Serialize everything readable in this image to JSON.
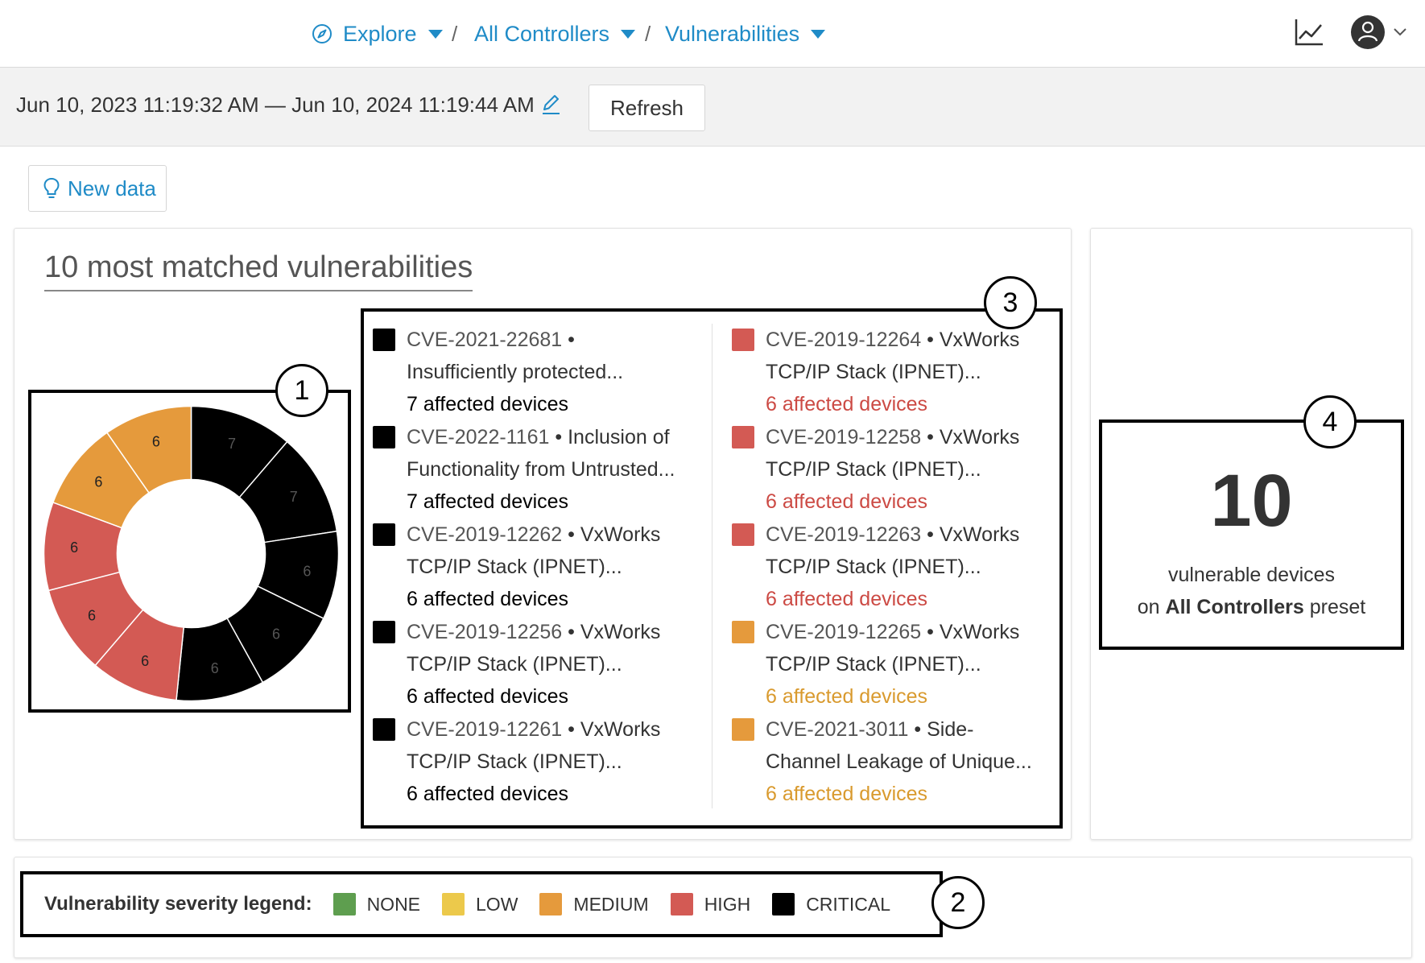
{
  "breadcrumb": {
    "explore": "Explore",
    "controllers": "All Controllers",
    "vulnerabilities": "Vulnerabilities",
    "separator": "/"
  },
  "header_icons": [
    "compass-icon",
    "line-chart-icon",
    "user-avatar-icon",
    "chevron-down-icon"
  ],
  "toolbar": {
    "date_range": "Jun 10, 2023 11:19:32 AM — Jun 10, 2024 11:19:44 AM",
    "refresh_label": "Refresh",
    "new_data_label": "New data"
  },
  "vulnerabilities_panel": {
    "title": "10 most matched vulnerabilities",
    "items": [
      {
        "cve": "CVE-2021-22681",
        "line1_rest": "•",
        "line2": "Insufficiently protected...",
        "affected": "7 affected devices",
        "severity": "critical"
      },
      {
        "cve": "CVE-2022-1161",
        "line1_rest": "• Inclusion of",
        "line2": "Functionality from Untrusted...",
        "affected": "7 affected devices",
        "severity": "critical"
      },
      {
        "cve": "CVE-2019-12262",
        "line1_rest": "• VxWorks",
        "line2": "TCP/IP Stack (IPNET)...",
        "affected": "6 affected devices",
        "severity": "critical"
      },
      {
        "cve": "CVE-2019-12256",
        "line1_rest": "• VxWorks",
        "line2": "TCP/IP Stack (IPNET)...",
        "affected": "6 affected devices",
        "severity": "critical"
      },
      {
        "cve": "CVE-2019-12261",
        "line1_rest": "• VxWorks",
        "line2": "TCP/IP Stack (IPNET)...",
        "affected": "6 affected devices",
        "severity": "critical"
      },
      {
        "cve": "CVE-2019-12264",
        "line1_rest": "• VxWorks",
        "line2": "TCP/IP Stack (IPNET)...",
        "affected": "6 affected devices",
        "severity": "high"
      },
      {
        "cve": "CVE-2019-12258",
        "line1_rest": "• VxWorks",
        "line2": "TCP/IP Stack (IPNET)...",
        "affected": "6 affected devices",
        "severity": "high"
      },
      {
        "cve": "CVE-2019-12263",
        "line1_rest": "• VxWorks",
        "line2": "TCP/IP Stack (IPNET)...",
        "affected": "6 affected devices",
        "severity": "high"
      },
      {
        "cve": "CVE-2019-12265",
        "line1_rest": "• VxWorks",
        "line2": "TCP/IP Stack (IPNET)...",
        "affected": "6 affected devices",
        "severity": "medium"
      },
      {
        "cve": "CVE-2021-3011",
        "line1_rest": "• Side-",
        "line2": "Channel Leakage of Unique...",
        "affected": "6 affected devices",
        "severity": "medium"
      }
    ]
  },
  "donut": {
    "segments": [
      {
        "value": 7,
        "severity": "critical"
      },
      {
        "value": 7,
        "severity": "critical"
      },
      {
        "value": 6,
        "severity": "critical"
      },
      {
        "value": 6,
        "severity": "critical"
      },
      {
        "value": 6,
        "severity": "critical"
      },
      {
        "value": 6,
        "severity": "high"
      },
      {
        "value": 6,
        "severity": "high"
      },
      {
        "value": 6,
        "severity": "high"
      },
      {
        "value": 6,
        "severity": "medium"
      },
      {
        "value": 6,
        "severity": "medium"
      }
    ]
  },
  "count_panel": {
    "number": "10",
    "line1": "vulnerable devices",
    "line2_prefix": "on",
    "line2_bold": "All Controllers",
    "line2_suffix": "preset"
  },
  "legend": {
    "title": "Vulnerability severity legend:",
    "items": [
      {
        "key": "none",
        "label": "NONE"
      },
      {
        "key": "low",
        "label": "LOW"
      },
      {
        "key": "medium",
        "label": "MEDIUM"
      },
      {
        "key": "high",
        "label": "HIGH"
      },
      {
        "key": "critical",
        "label": "CRITICAL"
      }
    ]
  },
  "severity_colors": {
    "none": "#5e9e4f",
    "low": "#ecc94b",
    "medium": "#e59a3c",
    "high": "#d35a54",
    "critical": "#000000"
  },
  "affected_text_colors": {
    "critical": "#000000",
    "high": "#cc4a44",
    "medium": "#d99a2e"
  },
  "accent_color": "#1f8bc7",
  "callouts": [
    "1",
    "2",
    "3",
    "4"
  ]
}
